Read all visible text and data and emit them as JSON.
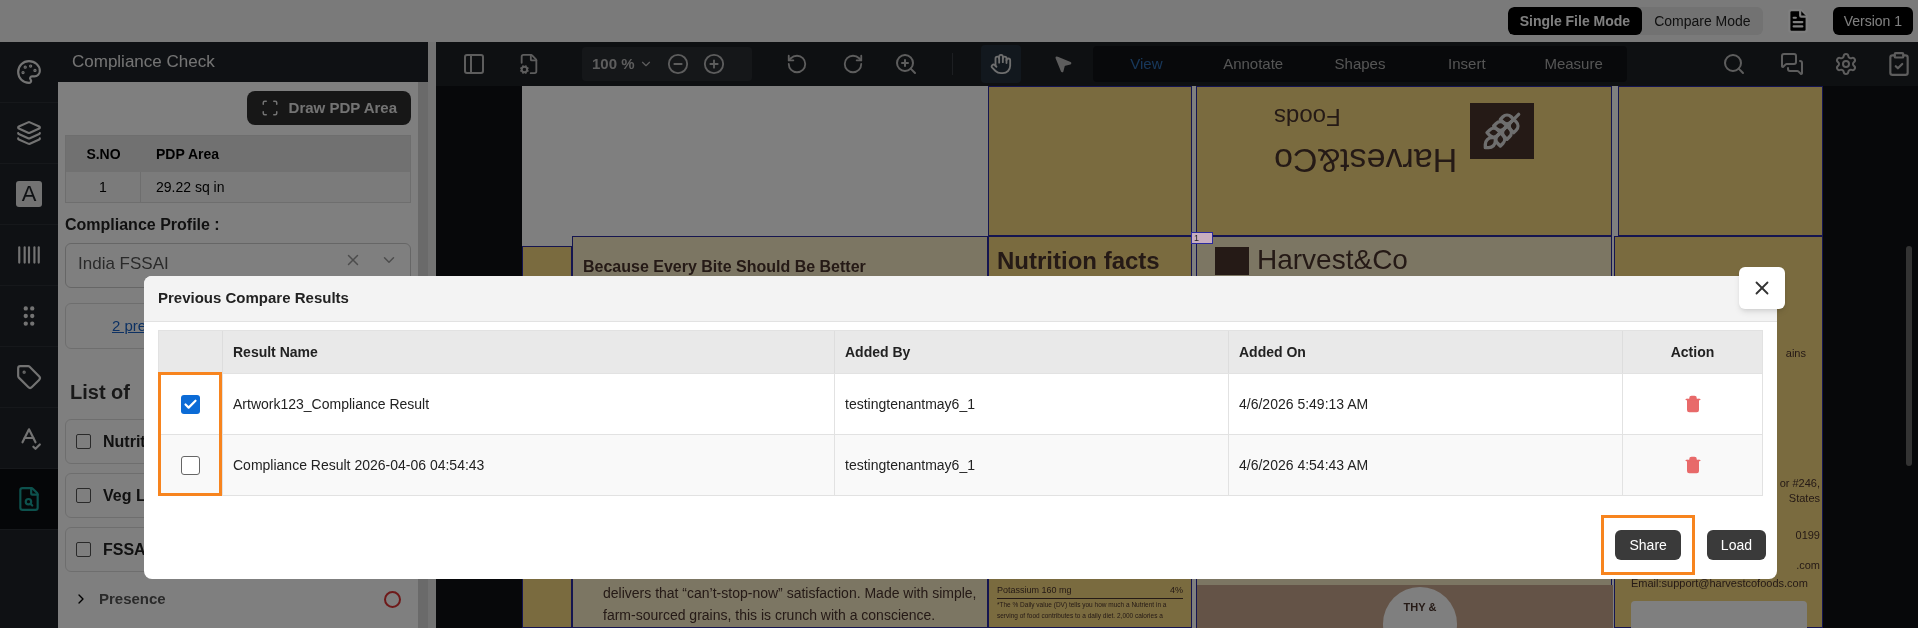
{
  "top_bar": {
    "modes": [
      {
        "label": "Single File Mode",
        "selected": true
      },
      {
        "label": "Compare Mode",
        "selected": false
      }
    ],
    "version": "Version 1"
  },
  "icon_rail": [
    {
      "kind": "palette",
      "selected": false
    },
    {
      "kind": "layers",
      "selected": false
    },
    {
      "kind": "text",
      "label": "A",
      "selected": false
    },
    {
      "kind": "barcode",
      "selected": false
    },
    {
      "kind": "grid",
      "selected": false
    },
    {
      "kind": "tag",
      "selected": false
    },
    {
      "kind": "spellcheck",
      "selected": false
    },
    {
      "kind": "compliance",
      "selected": true
    }
  ],
  "left_panel": {
    "title": "Compliance Check",
    "draw_button": "Draw PDP Area",
    "pdp_table": {
      "columns": [
        "S.NO",
        "PDP Area"
      ],
      "rows": [
        [
          "1",
          "29.22 sq in"
        ]
      ]
    },
    "profile_label": "Compliance Profile :",
    "profile_value": "India FSSAI",
    "results_link": "2 pre",
    "list_title": "List of",
    "checks": [
      {
        "label": "Nutrit",
        "checked": false
      },
      {
        "label": "Veg L",
        "checked": false
      },
      {
        "label": "FSSA",
        "checked": false
      }
    ],
    "presence": {
      "label": "Presence",
      "expanded": false
    }
  },
  "toolbar": {
    "zoom": "100 %",
    "tabs": [
      {
        "label": "View",
        "selected": true
      },
      {
        "label": "Annotate",
        "selected": false
      },
      {
        "label": "Shapes",
        "selected": false
      },
      {
        "label": "Insert",
        "selected": false
      },
      {
        "label": "Measure",
        "selected": false
      }
    ]
  },
  "document": {
    "lid_brand": "Harvest&Co",
    "lid_sub": "Foods",
    "page_marker": "1",
    "headline": "Because Every Bite Should Be Better",
    "nutrition_title": "Nutrition facts",
    "front_brand": "Harvest&Co",
    "body_lines": [
      "delivers that “can’t-stop-now” satisfaction. Made with simple,",
      "farm-sourced grains, this is crunch with a conscience."
    ],
    "nutrient": {
      "name": "Potassium 160 mg",
      "value": "4%"
    },
    "footnote_lines": [
      "*The % Daily value (DV) tells you how much a Nutrient in a",
      "serving of food contributes to a daily diet. 2,000 calories a"
    ],
    "badge": "THY &",
    "side_fragments": [
      "ains",
      "or #246,",
      "States",
      "0199",
      ".com"
    ],
    "email": "Email:support@harvestcofoods.com"
  },
  "dialog": {
    "title": "Previous Compare Results",
    "columns": [
      "Result Name",
      "Added By",
      "Added On",
      "Action"
    ],
    "rows": [
      {
        "checked": true,
        "name": "Artwork123_Compliance Result",
        "added_by": "testingtenantmay6_1",
        "added_on": "4/6/2026 5:49:13 AM"
      },
      {
        "checked": false,
        "name": "Compliance Result 2026-04-06 04:54:43",
        "added_by": "testingtenantmay6_1",
        "added_on": "4/6/2026 4:54:43 AM"
      }
    ],
    "checkbox_column_highlighted": true,
    "buttons": [
      {
        "label": "Share",
        "highlighted": true
      },
      {
        "label": "Load",
        "highlighted": false
      }
    ]
  }
}
